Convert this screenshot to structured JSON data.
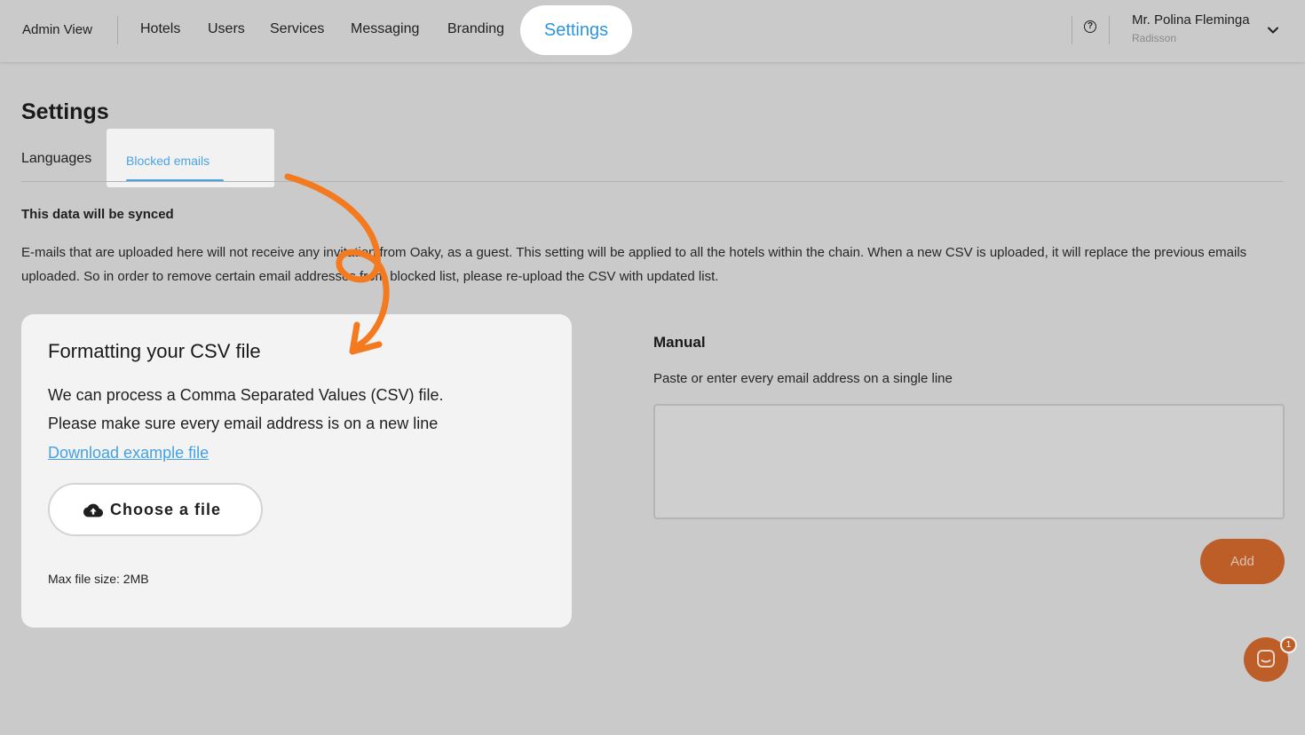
{
  "nav": {
    "admin_view": "Admin View",
    "items": [
      "Hotels",
      "Users",
      "Services",
      "Messaging",
      "Branding"
    ],
    "active": "Settings",
    "help_icon": "question-circle-icon",
    "user": {
      "name": "Mr. Polina Fleminga",
      "org": "Radisson"
    }
  },
  "page": {
    "title": "Settings",
    "tabs": [
      {
        "label": "Languages",
        "active": false
      },
      {
        "label": "Blocked emails",
        "active": true
      }
    ]
  },
  "info": {
    "heading": "This data will be synced",
    "description": "E-mails that are uploaded here will not receive any invitation from Oaky, as a guest. This setting will be applied to all the hotels within the chain. When a new CSV is uploaded, it will replace the previous emails uploaded. So in order to remove certain email addresses from blocked list, please re-upload the CSV with updated list."
  },
  "csv": {
    "title": "Formatting your CSV file",
    "line1": "We can process a Comma Separated Values (CSV) file.",
    "line2": "Please make sure every email address is on a new line",
    "download_link": "Download example file",
    "choose_button": "Choose a file",
    "upload_icon": "cloud-upload-icon",
    "max_size": "Max file size: 2MB"
  },
  "manual": {
    "title": "Manual",
    "hint": "Paste or enter every email address on a single line",
    "textarea_value": "",
    "add_button": "Add"
  },
  "chat": {
    "icon": "chat-bubble-icon",
    "badge": "1"
  },
  "colors": {
    "accent_blue": "#2d95dd",
    "brand_orange": "#bd5e28",
    "annotation_orange": "#f47a1f",
    "overlay_gray": "#cacaca"
  }
}
